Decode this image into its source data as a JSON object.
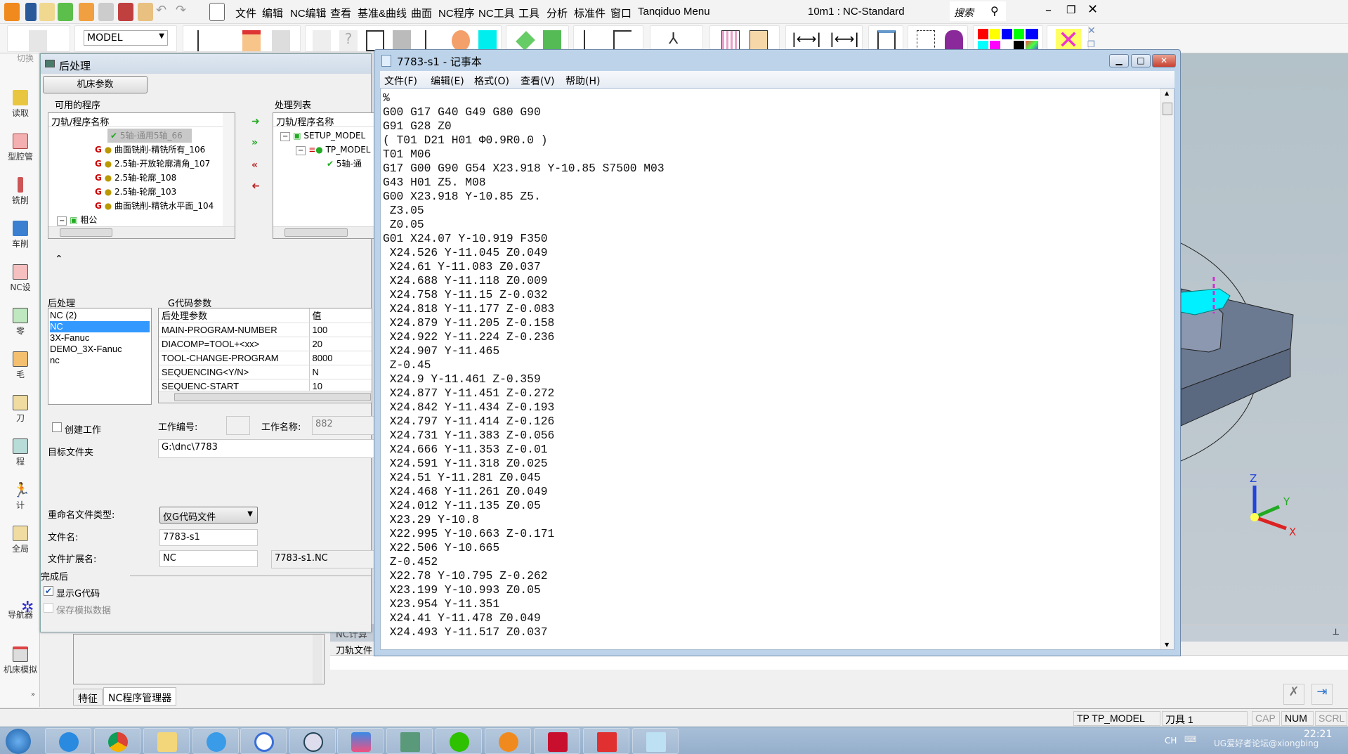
{
  "app": {
    "title": "10m1 : NC-Standard",
    "search_label": "搜索",
    "menu": [
      "文件",
      "编辑",
      "NC编辑",
      "查看",
      "基准&曲线",
      "曲面",
      "NC程序",
      "NC工具",
      "工具",
      "分析",
      "标准件",
      "窗口",
      "Tanqiduo Menu"
    ],
    "model_select": "MODEL",
    "switch_label": "切换"
  },
  "sidebar": {
    "items": [
      {
        "label": "读取",
        "icon": "read-icon"
      },
      {
        "label": "型腔管",
        "icon": "cavity-icon"
      },
      {
        "label": "铣削",
        "icon": "milling-icon"
      },
      {
        "label": "车削",
        "icon": "turning-icon"
      },
      {
        "label": "NC设",
        "icon": "nc-setup-icon"
      },
      {
        "label": "零",
        "icon": "part-icon"
      },
      {
        "label": "毛",
        "icon": "stock-icon"
      },
      {
        "label": "刀",
        "icon": "tool-icon"
      },
      {
        "label": "程",
        "icon": "program-icon"
      },
      {
        "label": "计",
        "icon": "compute-icon"
      },
      {
        "label": "全局",
        "icon": "global-icon"
      },
      {
        "label": "导航器",
        "icon": "navigator-icon"
      },
      {
        "label": "机床模拟",
        "icon": "machine-sim-icon"
      }
    ]
  },
  "dialog": {
    "title": "后处理",
    "machine_params_button": "机床参数",
    "available_label": "可用的程序",
    "processing_label": "处理列表",
    "tree_header": "刀轨/程序名称",
    "available_items": [
      "5轴-通用5轴_66",
      "曲面铣削-精铣所有_106",
      "2.5轴-开放轮廓清角_107",
      "2.5轴-轮廓_108",
      "2.5轴-轮廓_103",
      "曲面铣削-精铣水平面_104",
      "粗公"
    ],
    "processing_items": [
      "SETUP_MODEL",
      "TP_MODEL",
      "5轴-通"
    ],
    "post_label": "后处理",
    "post_list": [
      "NC (2)",
      "NC",
      "3X-Fanuc",
      "DEMO_3X-Fanuc",
      "nc"
    ],
    "post_selected": "NC",
    "gcode_label": "G代码参数",
    "param_headers": [
      "后处理参数",
      "值"
    ],
    "params": [
      [
        "MAIN-PROGRAM-NUMBER",
        "100"
      ],
      [
        "DIACOMP=TOOL+<xx>",
        "20"
      ],
      [
        "TOOL-CHANGE-PROGRAM",
        "8000"
      ],
      [
        "SEQUENCING<Y/N>",
        "N"
      ],
      [
        "SEQUENC-START",
        "10"
      ]
    ],
    "create_job_label": "创建工作",
    "create_job_checked": false,
    "job_number_label": "工作编号:",
    "job_number_value": "",
    "job_name_label": "工作名称:",
    "job_name_value": "882",
    "target_folder_label": "目标文件夹",
    "target_folder_value": "G:\\dnc\\7783",
    "rename_type_label": "重命名文件类型:",
    "rename_type_value": "仅G代码文件",
    "filename_label": "文件名:",
    "filename_value": "7783-s1",
    "ext_label": "文件扩展名:",
    "ext_value": "NC",
    "full_name": "7783-s1.NC",
    "after_label": "完成后",
    "show_gcode_label": "显示G代码",
    "show_gcode_checked": true,
    "save_sim_label": "保存模拟数据",
    "save_sim_checked": false
  },
  "notepad": {
    "title": "7783-s1 - 记事本",
    "menu": [
      "文件(F)",
      "编辑(E)",
      "格式(O)",
      "查看(V)",
      "帮助(H)"
    ],
    "lines": [
      "%",
      "G00 G17 G40 G49 G80 G90",
      "G91 G28 Z0",
      "( T01 D21 H01 Φ0.9R0.0 )",
      "T01 M06",
      "G17 G00 G90 G54 X23.918 Y-10.85 S7500 M03",
      "G43 H01 Z5. M08",
      "G00 X23.918 Y-10.85 Z5.",
      " Z3.05",
      " Z0.05",
      "G01 X24.07 Y-10.919 F350",
      " X24.526 Y-11.045 Z0.049",
      " X24.61 Y-11.083 Z0.037",
      " X24.688 Y-11.118 Z0.009",
      " X24.758 Y-11.15 Z-0.032",
      " X24.818 Y-11.177 Z-0.083",
      " X24.879 Y-11.205 Z-0.158",
      " X24.922 Y-11.224 Z-0.236",
      " X24.907 Y-11.465",
      " Z-0.45",
      " X24.9 Y-11.461 Z-0.359",
      " X24.877 Y-11.451 Z-0.272",
      " X24.842 Y-11.434 Z-0.193",
      " X24.797 Y-11.414 Z-0.126",
      " X24.731 Y-11.383 Z-0.056",
      " X24.666 Y-11.353 Z-0.01",
      " X24.591 Y-11.318 Z0.025",
      " X24.51 Y-11.281 Z0.045",
      " X24.468 Y-11.261 Z0.049",
      " X24.012 Y-11.135 Z0.05",
      " X23.29 Y-10.8",
      " X22.995 Y-10.663 Z-0.171",
      " X22.506 Y-10.665",
      " Z-0.452",
      " X22.78 Y-10.795 Z-0.262",
      " X23.199 Y-10.993 Z0.05",
      " X23.954 Y-11.351",
      " X24.41 Y-11.478 Z0.049",
      " X24.493 Y-11.517 Z0.037"
    ]
  },
  "bottom": {
    "tabs": [
      "特征",
      "NC程序管理器"
    ],
    "active_tab": "NC程序管理器",
    "nc_panel_title": "NC计算",
    "nc_col_header": "刀轨文件"
  },
  "viewport": {
    "axes": [
      "X",
      "Y",
      "Z"
    ]
  },
  "status": {
    "toolpath": "TP  TP_MODEL",
    "tool": "刀具 1",
    "cap": "CAP",
    "num": "NUM",
    "scrl": "SCRL"
  },
  "taskbar": {
    "apps": [
      "ie-icon",
      "chrome-icon",
      "explorer-icon",
      "ie2-icon",
      "iu-icon",
      "remote-icon",
      "abc-icon",
      "window-icon",
      "wechat-icon",
      "cimatron-icon",
      "solidworks-icon",
      "app-red-icon",
      "notepad-icon"
    ],
    "lang": "CH",
    "time": "22:21",
    "watermark": "UG爱好者论坛@xiongbing"
  },
  "colors": {
    "accent": "#3399ff",
    "palette": [
      "#ff0000",
      "#ffff00",
      "#0000ff",
      "#00ff00",
      "#00ffff",
      "#ff00ff",
      "#ffffff",
      "#000000"
    ]
  }
}
